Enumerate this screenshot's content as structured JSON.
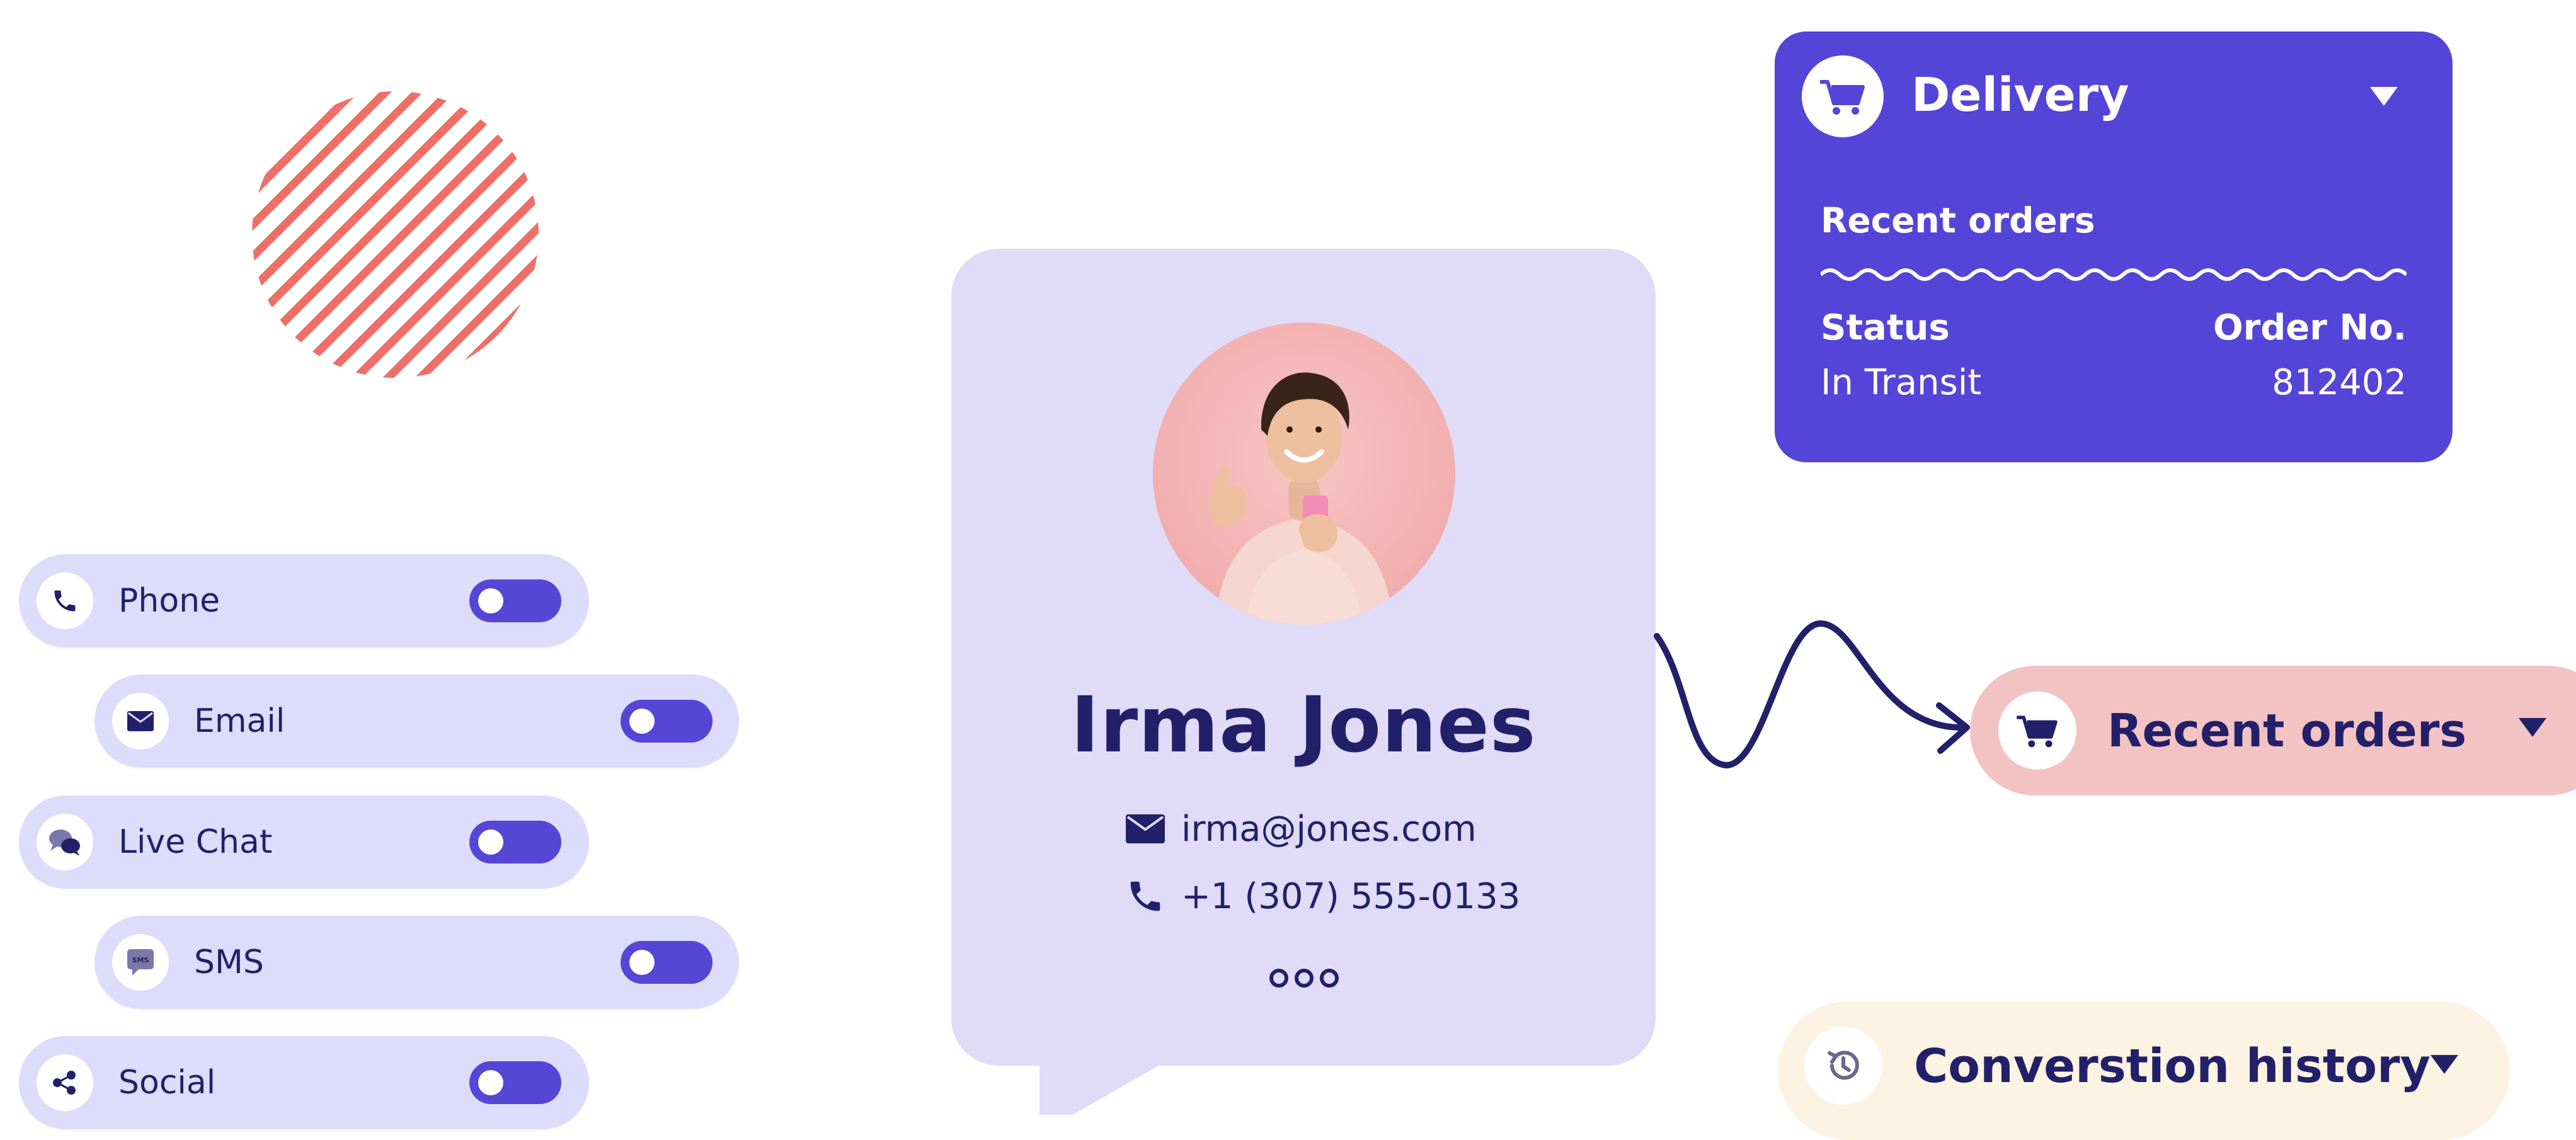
{
  "channels": [
    {
      "label": "Phone",
      "icon": "phone-icon",
      "enabled": true
    },
    {
      "label": "Email",
      "icon": "envelope-icon",
      "enabled": true
    },
    {
      "label": "Live Chat",
      "icon": "chat-icon",
      "enabled": true
    },
    {
      "label": "SMS",
      "icon": "sms-icon",
      "enabled": true,
      "icon_text": "SMS"
    },
    {
      "label": "Social",
      "icon": "share-icon",
      "enabled": true
    }
  ],
  "profile": {
    "name": "Irma Jones",
    "email": "irma@jones.com",
    "phone": "+1 (307) 555-0133",
    "avatar": "avatar-photo"
  },
  "delivery": {
    "title": "Delivery",
    "subtitle": "Recent orders",
    "status_header": "Status",
    "order_header": "Order No.",
    "status_value": "In Transit",
    "order_value": "812402"
  },
  "recent_orders": {
    "label": "Recent orders"
  },
  "history": {
    "label": "Converstion history"
  },
  "colors": {
    "primary": "#5544d8",
    "navy": "#23206a",
    "lavender": "#dedcfb",
    "card": "#e0dbf7",
    "pink": "#f3c3c3",
    "cream": "#fdf3e3",
    "coral": "#ee6f68"
  }
}
